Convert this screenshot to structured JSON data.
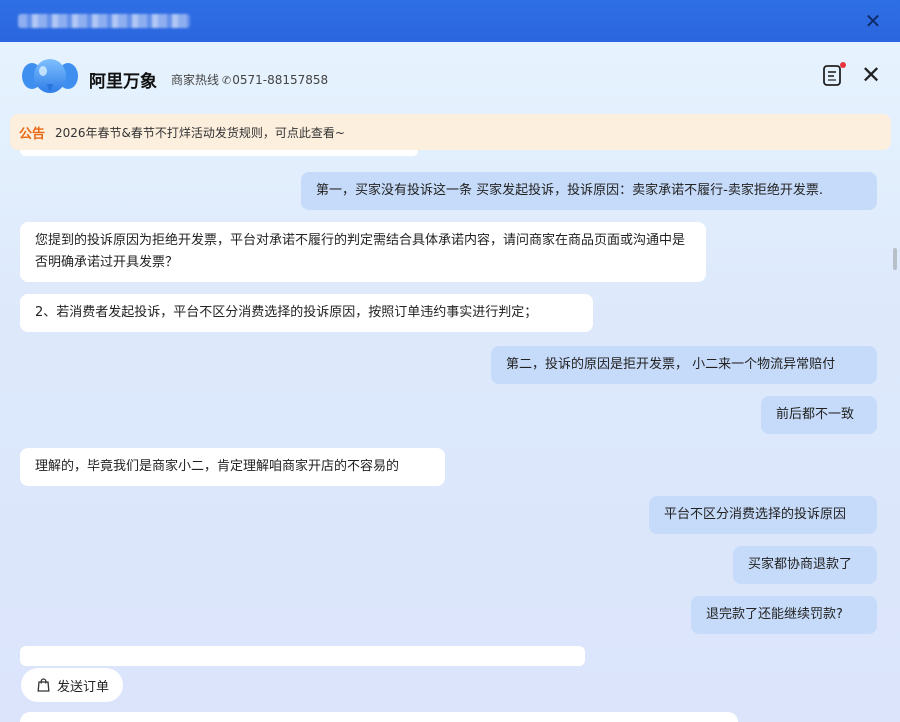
{
  "window": {
    "close_glyph": "✕"
  },
  "header": {
    "app_name": "阿里万象",
    "hotline_label": "商家热线",
    "hotline_number": "0571-88157858",
    "notes_icon": "notes-icon",
    "close_glyph": "✕"
  },
  "notice": {
    "tag": "公告",
    "text": "2026年春节&春节不打烊活动发货规则，可点此查看~"
  },
  "messages": [
    {
      "role": "user",
      "text": "第一，买家没有投诉这一条 买家发起投诉，投诉原因：卖家承诺不履行-卖家拒绝开发票."
    },
    {
      "role": "bot",
      "text": "您提到的投诉原因为拒绝开发票，平台对承诺不履行的判定需结合具体承诺内容，请问商家在商品页面或沟通中是否明确承诺过开具发票？"
    },
    {
      "role": "bot",
      "text": "2、若消费者发起投诉，平台不区分消费选择的投诉原因，按照订单违约事实进行判定；"
    },
    {
      "role": "user",
      "text": "第二，投诉的原因是拒开发票， 小二来一个物流异常赔付"
    },
    {
      "role": "user",
      "text": "前后都不一致"
    },
    {
      "role": "bot",
      "text": "理解的，毕竟我们是商家小二，肯定理解咱商家开店的不容易的"
    },
    {
      "role": "user",
      "text": "平台不区分消费选择的投诉原因"
    },
    {
      "role": "user",
      "text": "买家都协商退款了"
    },
    {
      "role": "user",
      "text": "退完款了还能继续罚款?"
    }
  ],
  "actions": {
    "send_order_label": "发送订单"
  },
  "colors": {
    "titlebar": "#2a66dd",
    "user_bubble": "#c6dbf9",
    "bot_bubble": "#ffffff",
    "notice_bg": "#fcefde",
    "notice_tag": "#e86a16"
  }
}
